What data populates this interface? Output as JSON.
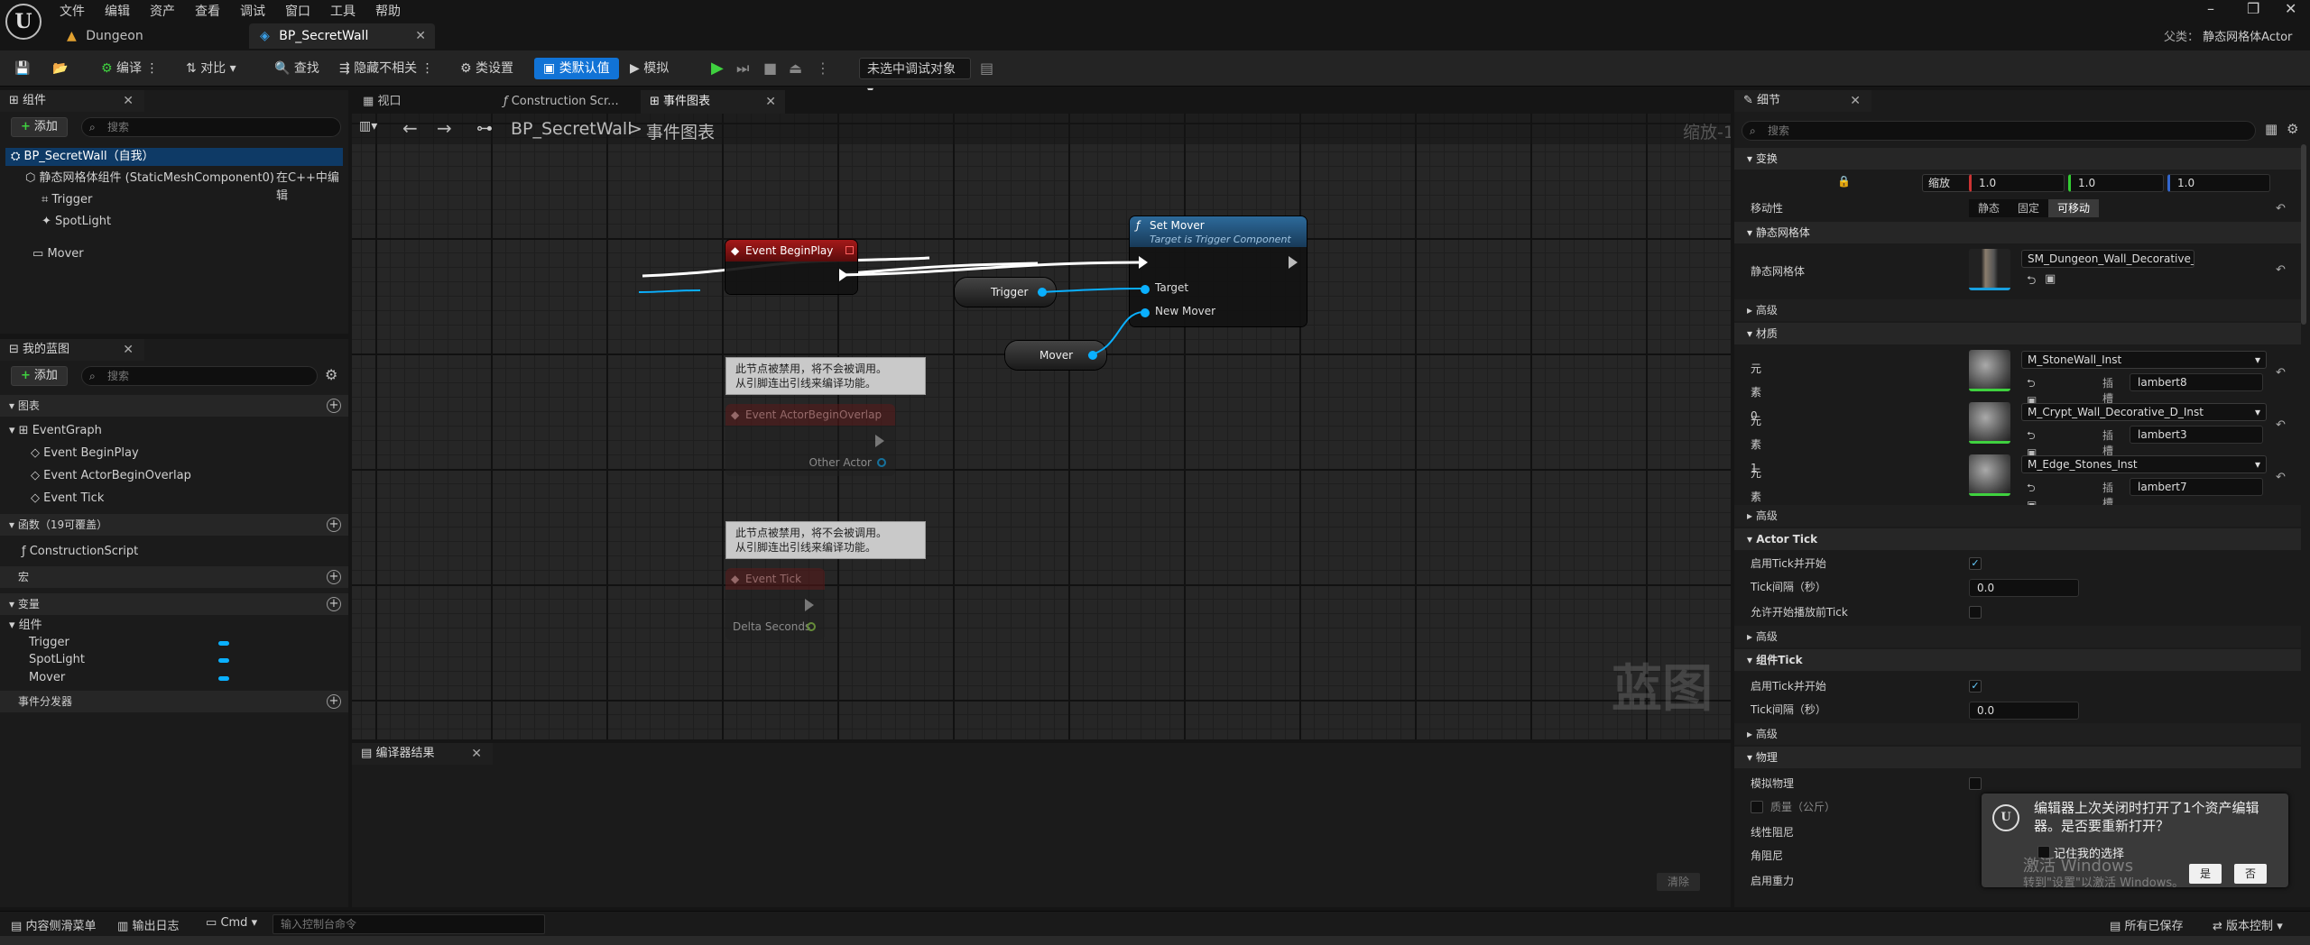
{
  "menu": [
    "文件",
    "编辑",
    "资产",
    "查看",
    "调试",
    "窗口",
    "工具",
    "帮助"
  ],
  "doc_tabs": [
    {
      "label": "Dungeon"
    },
    {
      "label": "BP_SecretWall"
    }
  ],
  "parent_class": {
    "label": "父类：",
    "value": "静态网格体Actor"
  },
  "toolbar": {
    "compile": "编译",
    "diff": "对比",
    "find": "查找",
    "hide_unrelated": "隐藏不相关",
    "class_settings": "类设置",
    "class_defaults": "类默认值",
    "simulate": "模拟",
    "debug_target": "未选中调试对象"
  },
  "components_panel": {
    "title": "组件",
    "add": "添加",
    "search_placeholder": "搜索",
    "items": [
      {
        "label": "BP_SecretWall（自我）"
      },
      {
        "label": "静态网格体组件 (StaticMeshComponent0)",
        "note": "在C++中编辑"
      },
      {
        "label": "Trigger"
      },
      {
        "label": "SpotLight"
      },
      {
        "label": "Mover"
      }
    ]
  },
  "my_blueprint": {
    "title": "我的蓝图",
    "add": "添加",
    "search_placeholder": "搜索",
    "graphs_title": "图表",
    "event_graph": "EventGraph",
    "events": [
      "Event BeginPlay",
      "Event ActorBeginOverlap",
      "Event Tick"
    ],
    "functions_title": "函数（19可覆盖）",
    "functions": [
      "ConstructionScript"
    ],
    "macros_title": "宏",
    "variables_title": "变量",
    "var_category": "组件",
    "variables": [
      "Trigger",
      "SpotLight",
      "Mover"
    ],
    "dispatchers_title": "事件分发器"
  },
  "editor_tabs": [
    {
      "label": "视口"
    },
    {
      "label": "Construction Scr..."
    },
    {
      "label": "事件图表"
    }
  ],
  "graph": {
    "breadcrumb_root": "BP_SecretWall",
    "breadcrumb_sep": ">",
    "breadcrumb_leaf": "事件图表",
    "zoom": "缩放-1",
    "watermark": "蓝图",
    "begin_play": "Event BeginPlay",
    "set_mover_title": "Set Mover",
    "set_mover_sub": "Target is Trigger Component",
    "pin_target": "Target",
    "pin_new_mover": "New Mover",
    "var_trigger": "Trigger",
    "var_mover": "Mover",
    "disabled_note_line1": "此节点被禁用，将不会被调用。",
    "disabled_note_line2": "从引脚连出引线来编译功能。",
    "overlap_title": "Event ActorBeginOverlap",
    "overlap_pin": "Other Actor",
    "tick_title": "Event Tick",
    "tick_pin": "Delta Seconds"
  },
  "compiler_results": {
    "title": "编译器结果",
    "clear": "清除"
  },
  "details": {
    "title": "细节",
    "search_placeholder": "搜索",
    "transform": "变换",
    "scale_label": "缩放",
    "scale_values": [
      "1.0",
      "1.0",
      "1.0"
    ],
    "mobility_label": "移动性",
    "mobility_options": [
      "静态",
      "固定",
      "可移动"
    ],
    "static_mesh_section": "静态网格体",
    "static_mesh_label": "静态网格体",
    "static_mesh_value": "SM_Dungeon_Wall_Decorative_D",
    "advanced": "高级",
    "materials_section": "材质",
    "materials": [
      {
        "label": "元素 0",
        "value": "M_StoneWall_Inst",
        "slot_label": "插槽",
        "slot": "lambert8"
      },
      {
        "label": "元素 1",
        "value": "M_Crypt_Wall_Decorative_D_Inst",
        "slot_label": "插槽",
        "slot": "lambert3"
      },
      {
        "label": "元素 2",
        "value": "M_Edge_Stones_Inst",
        "slot_label": "插槽",
        "slot": "lambert7"
      }
    ],
    "actor_tick": "Actor Tick",
    "tick_enabled": "启用Tick并开始",
    "tick_interval": "Tick间隔（秒）",
    "tick_interval_value": "0.0",
    "allow_tick_before_begin": "允许开始播放前Tick",
    "component_tick": "组件Tick",
    "physics": "物理",
    "simulate_physics": "模拟物理",
    "mass": "质量（公斤）",
    "linear_damping": "线性阻尼",
    "angular_damping": "角阻尼",
    "enable_gravity": "启用重力"
  },
  "toast": {
    "message": "编辑器上次关闭时打开了1个资产编辑器。是否要重新打开？",
    "remember": "记住我的选择",
    "yes": "是",
    "no": "否",
    "watermark1": "激活 Windows",
    "watermark2": "转到\"设置\"以激活 Windows。"
  },
  "statusbar": {
    "content_drawer": "内容侧滑菜单",
    "output_log": "输出日志",
    "cmd": "Cmd",
    "console_placeholder": "输入控制台命令",
    "all_saved": "所有已保存",
    "source_control": "版本控制"
  },
  "colors": {
    "accent_blue": "#1173d6",
    "event_red": "#a51919",
    "function_blue": "#2d6a9a",
    "object_pin": "#0ab0ff",
    "play_green": "#3fd13f"
  }
}
